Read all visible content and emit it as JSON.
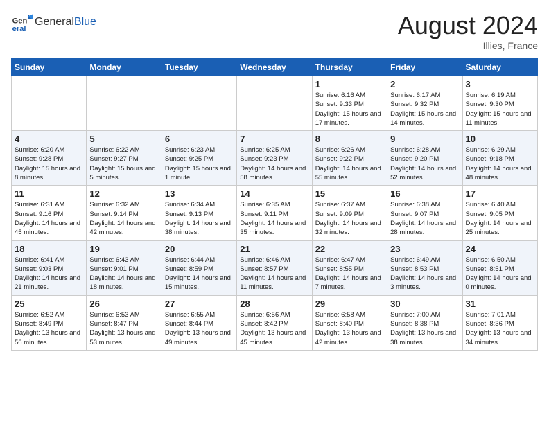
{
  "header": {
    "logo_general": "General",
    "logo_blue": "Blue",
    "month_year": "August 2024",
    "location": "Illies, France"
  },
  "days_of_week": [
    "Sunday",
    "Monday",
    "Tuesday",
    "Wednesday",
    "Thursday",
    "Friday",
    "Saturday"
  ],
  "weeks": [
    [
      {
        "num": "",
        "info": ""
      },
      {
        "num": "",
        "info": ""
      },
      {
        "num": "",
        "info": ""
      },
      {
        "num": "",
        "info": ""
      },
      {
        "num": "1",
        "info": "Sunrise: 6:16 AM\nSunset: 9:33 PM\nDaylight: 15 hours and 17 minutes."
      },
      {
        "num": "2",
        "info": "Sunrise: 6:17 AM\nSunset: 9:32 PM\nDaylight: 15 hours and 14 minutes."
      },
      {
        "num": "3",
        "info": "Sunrise: 6:19 AM\nSunset: 9:30 PM\nDaylight: 15 hours and 11 minutes."
      }
    ],
    [
      {
        "num": "4",
        "info": "Sunrise: 6:20 AM\nSunset: 9:28 PM\nDaylight: 15 hours and 8 minutes."
      },
      {
        "num": "5",
        "info": "Sunrise: 6:22 AM\nSunset: 9:27 PM\nDaylight: 15 hours and 5 minutes."
      },
      {
        "num": "6",
        "info": "Sunrise: 6:23 AM\nSunset: 9:25 PM\nDaylight: 15 hours and 1 minute."
      },
      {
        "num": "7",
        "info": "Sunrise: 6:25 AM\nSunset: 9:23 PM\nDaylight: 14 hours and 58 minutes."
      },
      {
        "num": "8",
        "info": "Sunrise: 6:26 AM\nSunset: 9:22 PM\nDaylight: 14 hours and 55 minutes."
      },
      {
        "num": "9",
        "info": "Sunrise: 6:28 AM\nSunset: 9:20 PM\nDaylight: 14 hours and 52 minutes."
      },
      {
        "num": "10",
        "info": "Sunrise: 6:29 AM\nSunset: 9:18 PM\nDaylight: 14 hours and 48 minutes."
      }
    ],
    [
      {
        "num": "11",
        "info": "Sunrise: 6:31 AM\nSunset: 9:16 PM\nDaylight: 14 hours and 45 minutes."
      },
      {
        "num": "12",
        "info": "Sunrise: 6:32 AM\nSunset: 9:14 PM\nDaylight: 14 hours and 42 minutes."
      },
      {
        "num": "13",
        "info": "Sunrise: 6:34 AM\nSunset: 9:13 PM\nDaylight: 14 hours and 38 minutes."
      },
      {
        "num": "14",
        "info": "Sunrise: 6:35 AM\nSunset: 9:11 PM\nDaylight: 14 hours and 35 minutes."
      },
      {
        "num": "15",
        "info": "Sunrise: 6:37 AM\nSunset: 9:09 PM\nDaylight: 14 hours and 32 minutes."
      },
      {
        "num": "16",
        "info": "Sunrise: 6:38 AM\nSunset: 9:07 PM\nDaylight: 14 hours and 28 minutes."
      },
      {
        "num": "17",
        "info": "Sunrise: 6:40 AM\nSunset: 9:05 PM\nDaylight: 14 hours and 25 minutes."
      }
    ],
    [
      {
        "num": "18",
        "info": "Sunrise: 6:41 AM\nSunset: 9:03 PM\nDaylight: 14 hours and 21 minutes."
      },
      {
        "num": "19",
        "info": "Sunrise: 6:43 AM\nSunset: 9:01 PM\nDaylight: 14 hours and 18 minutes."
      },
      {
        "num": "20",
        "info": "Sunrise: 6:44 AM\nSunset: 8:59 PM\nDaylight: 14 hours and 15 minutes."
      },
      {
        "num": "21",
        "info": "Sunrise: 6:46 AM\nSunset: 8:57 PM\nDaylight: 14 hours and 11 minutes."
      },
      {
        "num": "22",
        "info": "Sunrise: 6:47 AM\nSunset: 8:55 PM\nDaylight: 14 hours and 7 minutes."
      },
      {
        "num": "23",
        "info": "Sunrise: 6:49 AM\nSunset: 8:53 PM\nDaylight: 14 hours and 3 minutes."
      },
      {
        "num": "24",
        "info": "Sunrise: 6:50 AM\nSunset: 8:51 PM\nDaylight: 14 hours and 0 minutes."
      }
    ],
    [
      {
        "num": "25",
        "info": "Sunrise: 6:52 AM\nSunset: 8:49 PM\nDaylight: 13 hours and 56 minutes."
      },
      {
        "num": "26",
        "info": "Sunrise: 6:53 AM\nSunset: 8:47 PM\nDaylight: 13 hours and 53 minutes."
      },
      {
        "num": "27",
        "info": "Sunrise: 6:55 AM\nSunset: 8:44 PM\nDaylight: 13 hours and 49 minutes."
      },
      {
        "num": "28",
        "info": "Sunrise: 6:56 AM\nSunset: 8:42 PM\nDaylight: 13 hours and 45 minutes."
      },
      {
        "num": "29",
        "info": "Sunrise: 6:58 AM\nSunset: 8:40 PM\nDaylight: 13 hours and 42 minutes."
      },
      {
        "num": "30",
        "info": "Sunrise: 7:00 AM\nSunset: 8:38 PM\nDaylight: 13 hours and 38 minutes."
      },
      {
        "num": "31",
        "info": "Sunrise: 7:01 AM\nSunset: 8:36 PM\nDaylight: 13 hours and 34 minutes."
      }
    ]
  ]
}
